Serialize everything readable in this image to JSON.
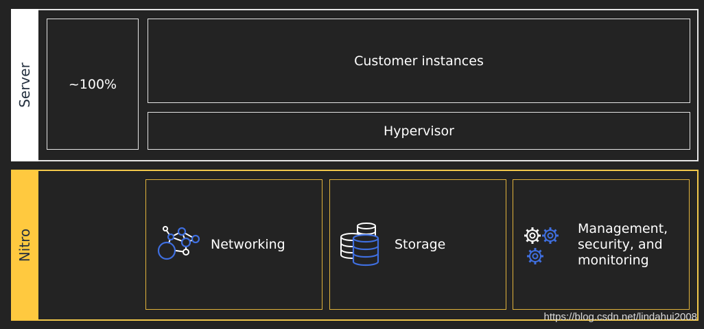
{
  "server": {
    "label": "Server",
    "percent": "~100%",
    "customer_instances": "Customer instances",
    "hypervisor": "Hypervisor"
  },
  "nitro": {
    "label": "Nitro",
    "cards": [
      {
        "label": "Networking",
        "icon": "network-graph-icon"
      },
      {
        "label": "Storage",
        "icon": "database-stack-icon"
      },
      {
        "label": "Management,\nsecurity, and\nmonitoring",
        "icon": "gears-icon"
      }
    ]
  },
  "watermark": "https://blog.csdn.net/lindahui2008",
  "colors": {
    "background": "#232323",
    "server_border": "#e6e6e6",
    "nitro_accent": "#ffc93f",
    "icon_blue": "#3f6fe0"
  }
}
